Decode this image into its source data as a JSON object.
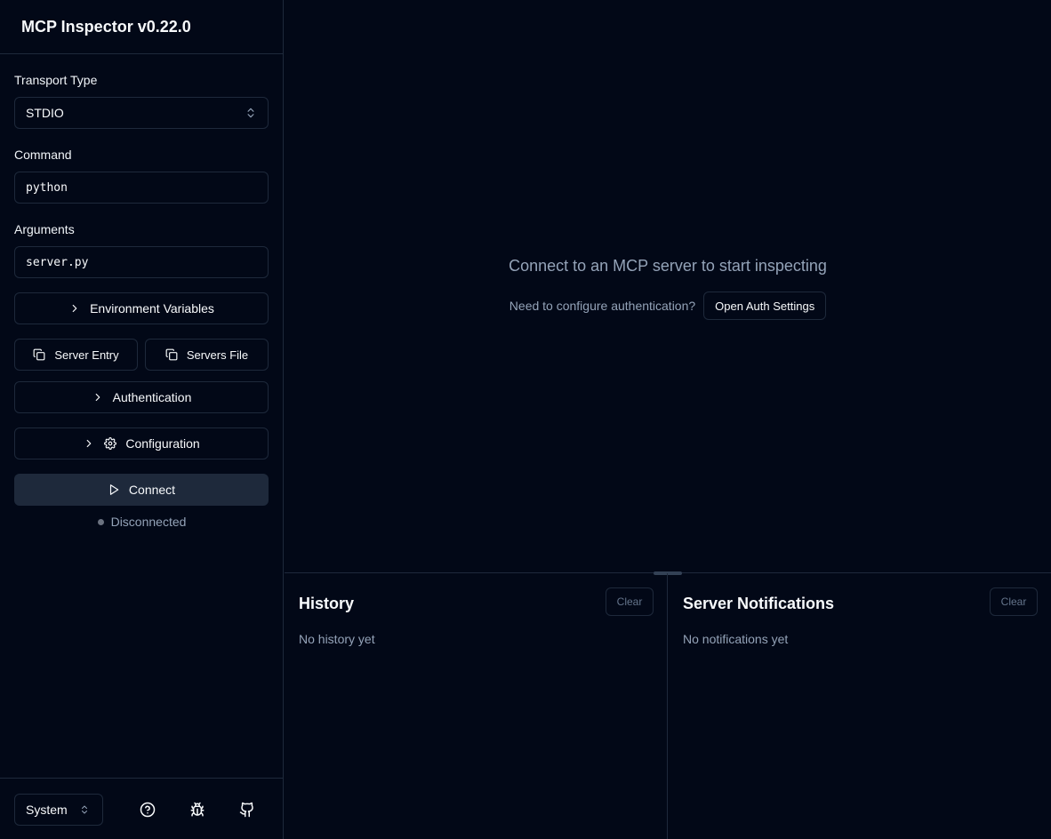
{
  "app": {
    "title": "MCP Inspector v0.22.0"
  },
  "sidebar": {
    "transport_label": "Transport Type",
    "transport_value": "STDIO",
    "command_label": "Command",
    "command_value": "python",
    "arguments_label": "Arguments",
    "arguments_value": "server.py",
    "env_vars_label": "Environment Variables",
    "server_entry_label": "Server Entry",
    "servers_file_label": "Servers File",
    "authentication_label": "Authentication",
    "configuration_label": "Configuration",
    "connect_label": "Connect",
    "status_text": "Disconnected",
    "status_color": "#6b7280"
  },
  "footer": {
    "theme_value": "System",
    "icons": [
      "help-circle-icon",
      "bug-icon",
      "github-icon"
    ]
  },
  "main": {
    "empty_title": "Connect to an MCP server to start inspecting",
    "auth_prompt": "Need to configure authentication?",
    "auth_button": "Open Auth Settings"
  },
  "history": {
    "title": "History",
    "clear_label": "Clear",
    "empty_text": "No history yet"
  },
  "notifications": {
    "title": "Server Notifications",
    "clear_label": "Clear",
    "empty_text": "No notifications yet"
  },
  "colors": {
    "background": "#020817",
    "border": "#1e293b",
    "muted_text": "#94a3b8",
    "connect_bg": "#1e293b"
  }
}
